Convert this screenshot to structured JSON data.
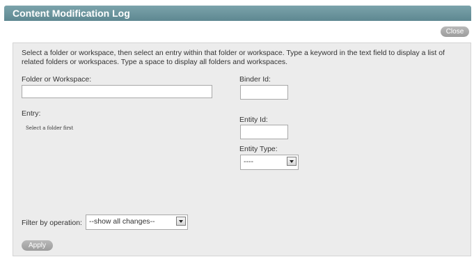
{
  "dialog": {
    "title": "Content Modification Log",
    "close_label": "Close"
  },
  "form": {
    "instructions": "Select a folder or workspace, then select an entry within that folder or workspace. Type a keyword in the text field to display a list of related folders or workspaces. Type a space to display all folders and workspaces.",
    "folder_label": "Folder or Workspace:",
    "folder_value": "",
    "binder_id_label": "Binder Id:",
    "binder_id_value": "",
    "entry_label": "Entry:",
    "entry_note": "Select a folder first",
    "entity_id_label": "Entity Id:",
    "entity_id_value": "",
    "entity_type_label": "Entity Type:",
    "entity_type_selected": "----",
    "filter_label": "Filter by operation:",
    "filter_selected": "--show all changes--",
    "apply_label": "Apply"
  },
  "colors": {
    "title_bar": "#6f97a0",
    "panel_bg": "#ececec",
    "button_bg": "#a9a9a9"
  }
}
